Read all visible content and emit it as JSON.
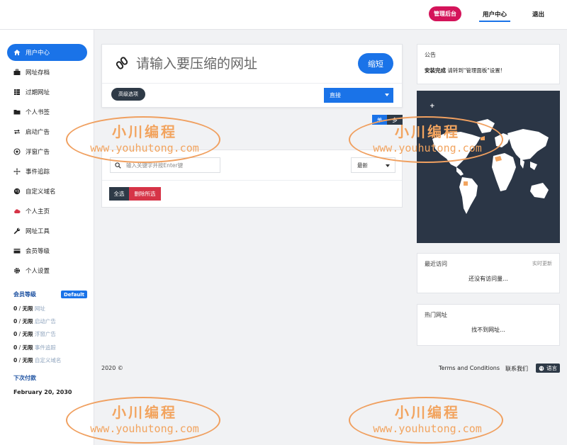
{
  "topbar": {
    "admin_label": "管理后台",
    "user_center_label": "用户中心",
    "logout_label": "退出"
  },
  "sidebar": {
    "items": [
      {
        "label": "用户中心",
        "icon": "home-icon"
      },
      {
        "label": "网址存档",
        "icon": "briefcase-icon"
      },
      {
        "label": "过期网址",
        "icon": "table-icon"
      },
      {
        "label": "个人书签",
        "icon": "folder-icon"
      },
      {
        "label": "启动广告",
        "icon": "swap-icon"
      },
      {
        "label": "浮窗广告",
        "icon": "target-icon"
      },
      {
        "label": "事件追踪",
        "icon": "crosshair-icon"
      },
      {
        "label": "自定义域名",
        "icon": "globe-icon"
      },
      {
        "label": "个人主页",
        "icon": "cloud-icon"
      },
      {
        "label": "网址工具",
        "icon": "wrench-icon"
      },
      {
        "label": "会员等级",
        "icon": "card-icon"
      },
      {
        "label": "个人设置",
        "icon": "gear-icon"
      }
    ],
    "membership": {
      "title": "会员等级",
      "badge": "Default",
      "quotas": [
        {
          "used": "0",
          "limit": "无限",
          "label": "网址"
        },
        {
          "used": "0",
          "limit": "无限",
          "label": "启动广告"
        },
        {
          "used": "0",
          "limit": "无限",
          "label": "浮窗广告"
        },
        {
          "used": "0",
          "limit": "无限",
          "label": "事件追踪"
        },
        {
          "used": "0",
          "limit": "无限",
          "label": "自定义域名"
        }
      ]
    },
    "next_payment": {
      "title": "下次付款",
      "date": "February 20, 2030"
    }
  },
  "shortener": {
    "placeholder": "请输入要压缩的网址",
    "shorten_label": "缩短",
    "advanced_label": "高级选项",
    "type_value": "直接"
  },
  "toggles": {
    "single": "单",
    "multi": "多"
  },
  "list": {
    "search_placeholder": "输入关键字并按Enter键",
    "sort_value": "最新",
    "select_all": "全选",
    "delete_selected": "删除所选"
  },
  "notice": {
    "title": "公告",
    "bold": "安装完成",
    "text": " 请转到\"管理面板\"设置!"
  },
  "map": {
    "zoom_in": "+",
    "zoom_out": "−"
  },
  "recent": {
    "title": "最近访问",
    "realtime": "实时更新",
    "empty": "还没有访问量..."
  },
  "popular": {
    "title": "热门网址",
    "empty": "找不到网址..."
  },
  "footer": {
    "copyright": "2020 ©",
    "terms": "Terms and Conditions",
    "contact": "联系我们",
    "language": "语言"
  },
  "watermark": {
    "cn": "小川编程",
    "en": "www.youhutong.com"
  },
  "colors": {
    "accent": "#1a73e8",
    "admin": "#d4145a",
    "danger": "#d63447",
    "dark": "#2e3a47",
    "map_bg": "#2b3646",
    "watermark": "#f2a45f"
  }
}
